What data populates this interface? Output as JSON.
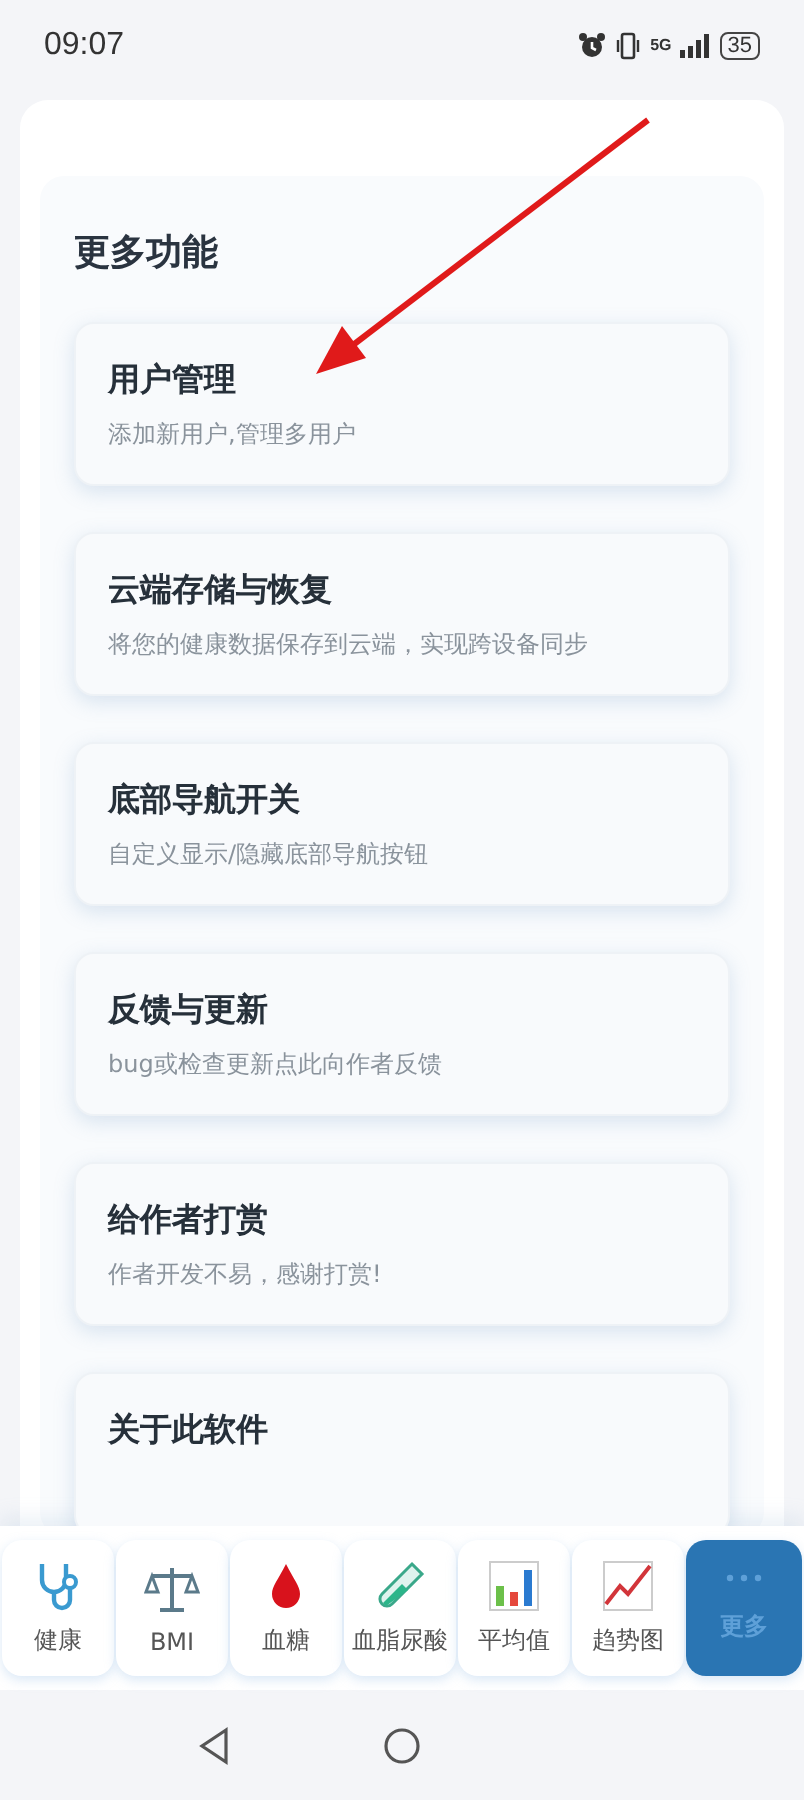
{
  "status_bar": {
    "time": "09:07",
    "battery": "35",
    "network": "5G"
  },
  "section": {
    "title": "更多功能",
    "items": [
      {
        "title": "用户管理",
        "subtitle": "添加新用户,管理多用户"
      },
      {
        "title": "云端存储与恢复",
        "subtitle": "将您的健康数据保存到云端，实现跨设备同步"
      },
      {
        "title": "底部导航开关",
        "subtitle": "自定义显示/隐藏底部导航按钮"
      },
      {
        "title": "反馈与更新",
        "subtitle": "bug或检查更新点此向作者反馈"
      },
      {
        "title": "给作者打赏",
        "subtitle": "作者开发不易，感谢打赏!"
      },
      {
        "title": "关于此软件"
      }
    ]
  },
  "bottom_nav": [
    {
      "label": "健康",
      "kind": "stethoscope",
      "selected": false
    },
    {
      "label": "BMI",
      "kind": "scale",
      "selected": false
    },
    {
      "label": "血糖",
      "kind": "drop",
      "selected": false
    },
    {
      "label": "血脂尿酸",
      "kind": "tube",
      "selected": false
    },
    {
      "label": "平均值",
      "kind": "bars",
      "selected": false
    },
    {
      "label": "趋势图",
      "kind": "trend",
      "selected": false
    },
    {
      "label": "更多",
      "kind": "more",
      "selected": true
    }
  ]
}
